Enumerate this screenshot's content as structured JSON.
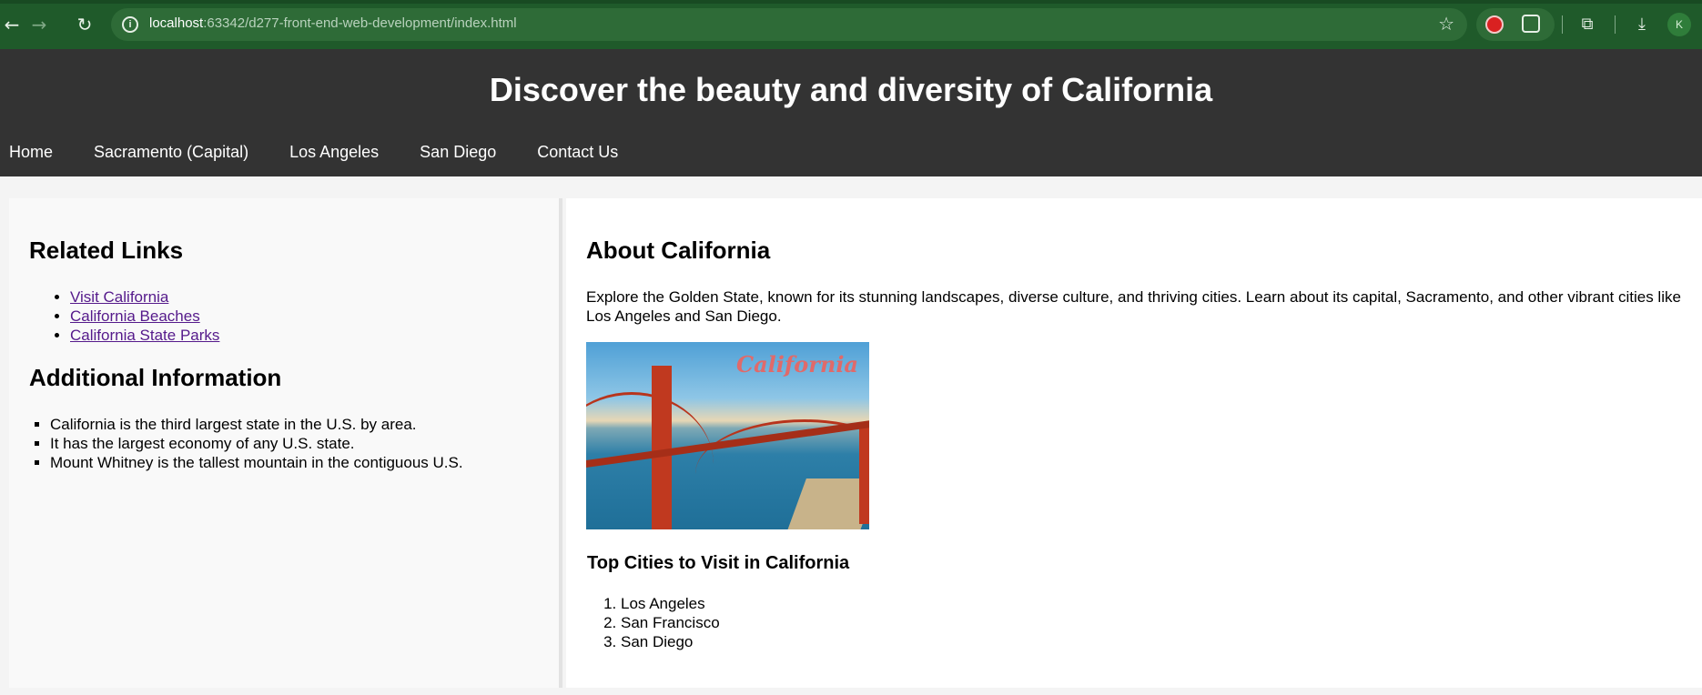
{
  "browser": {
    "url_host": "localhost",
    "url_rest": ":63342/d277-front-end-web-development/index.html",
    "profile_initial": "K"
  },
  "header": {
    "title": "Discover the beauty and diversity of California",
    "nav": [
      "Home",
      "Sacramento (Capital)",
      "Los Angeles",
      "San Diego",
      "Contact Us"
    ]
  },
  "sidebar": {
    "related_heading": "Related Links",
    "related_links": [
      "Visit California",
      "California Beaches",
      "California State Parks"
    ],
    "info_heading": "Additional Information",
    "info_items": [
      "California is the third largest state in the U.S. by area.",
      "It has the largest economy of any U.S. state.",
      "Mount Whitney is the tallest mountain in the contiguous U.S."
    ]
  },
  "main": {
    "heading": "About California",
    "intro": "Explore the Golden State, known for its stunning landscapes, diverse culture, and thriving cities. Learn about its capital, Sacramento, and other vibrant cities like Los Angeles and San Diego.",
    "image_caption": "California",
    "cities_heading": "Top Cities to Visit in California",
    "cities": [
      "Los Angeles",
      "San Francisco",
      "San Diego"
    ]
  },
  "colors": {
    "chrome": "#1f5a2a",
    "header_bg": "#333333",
    "visited_link": "#551a8b"
  }
}
